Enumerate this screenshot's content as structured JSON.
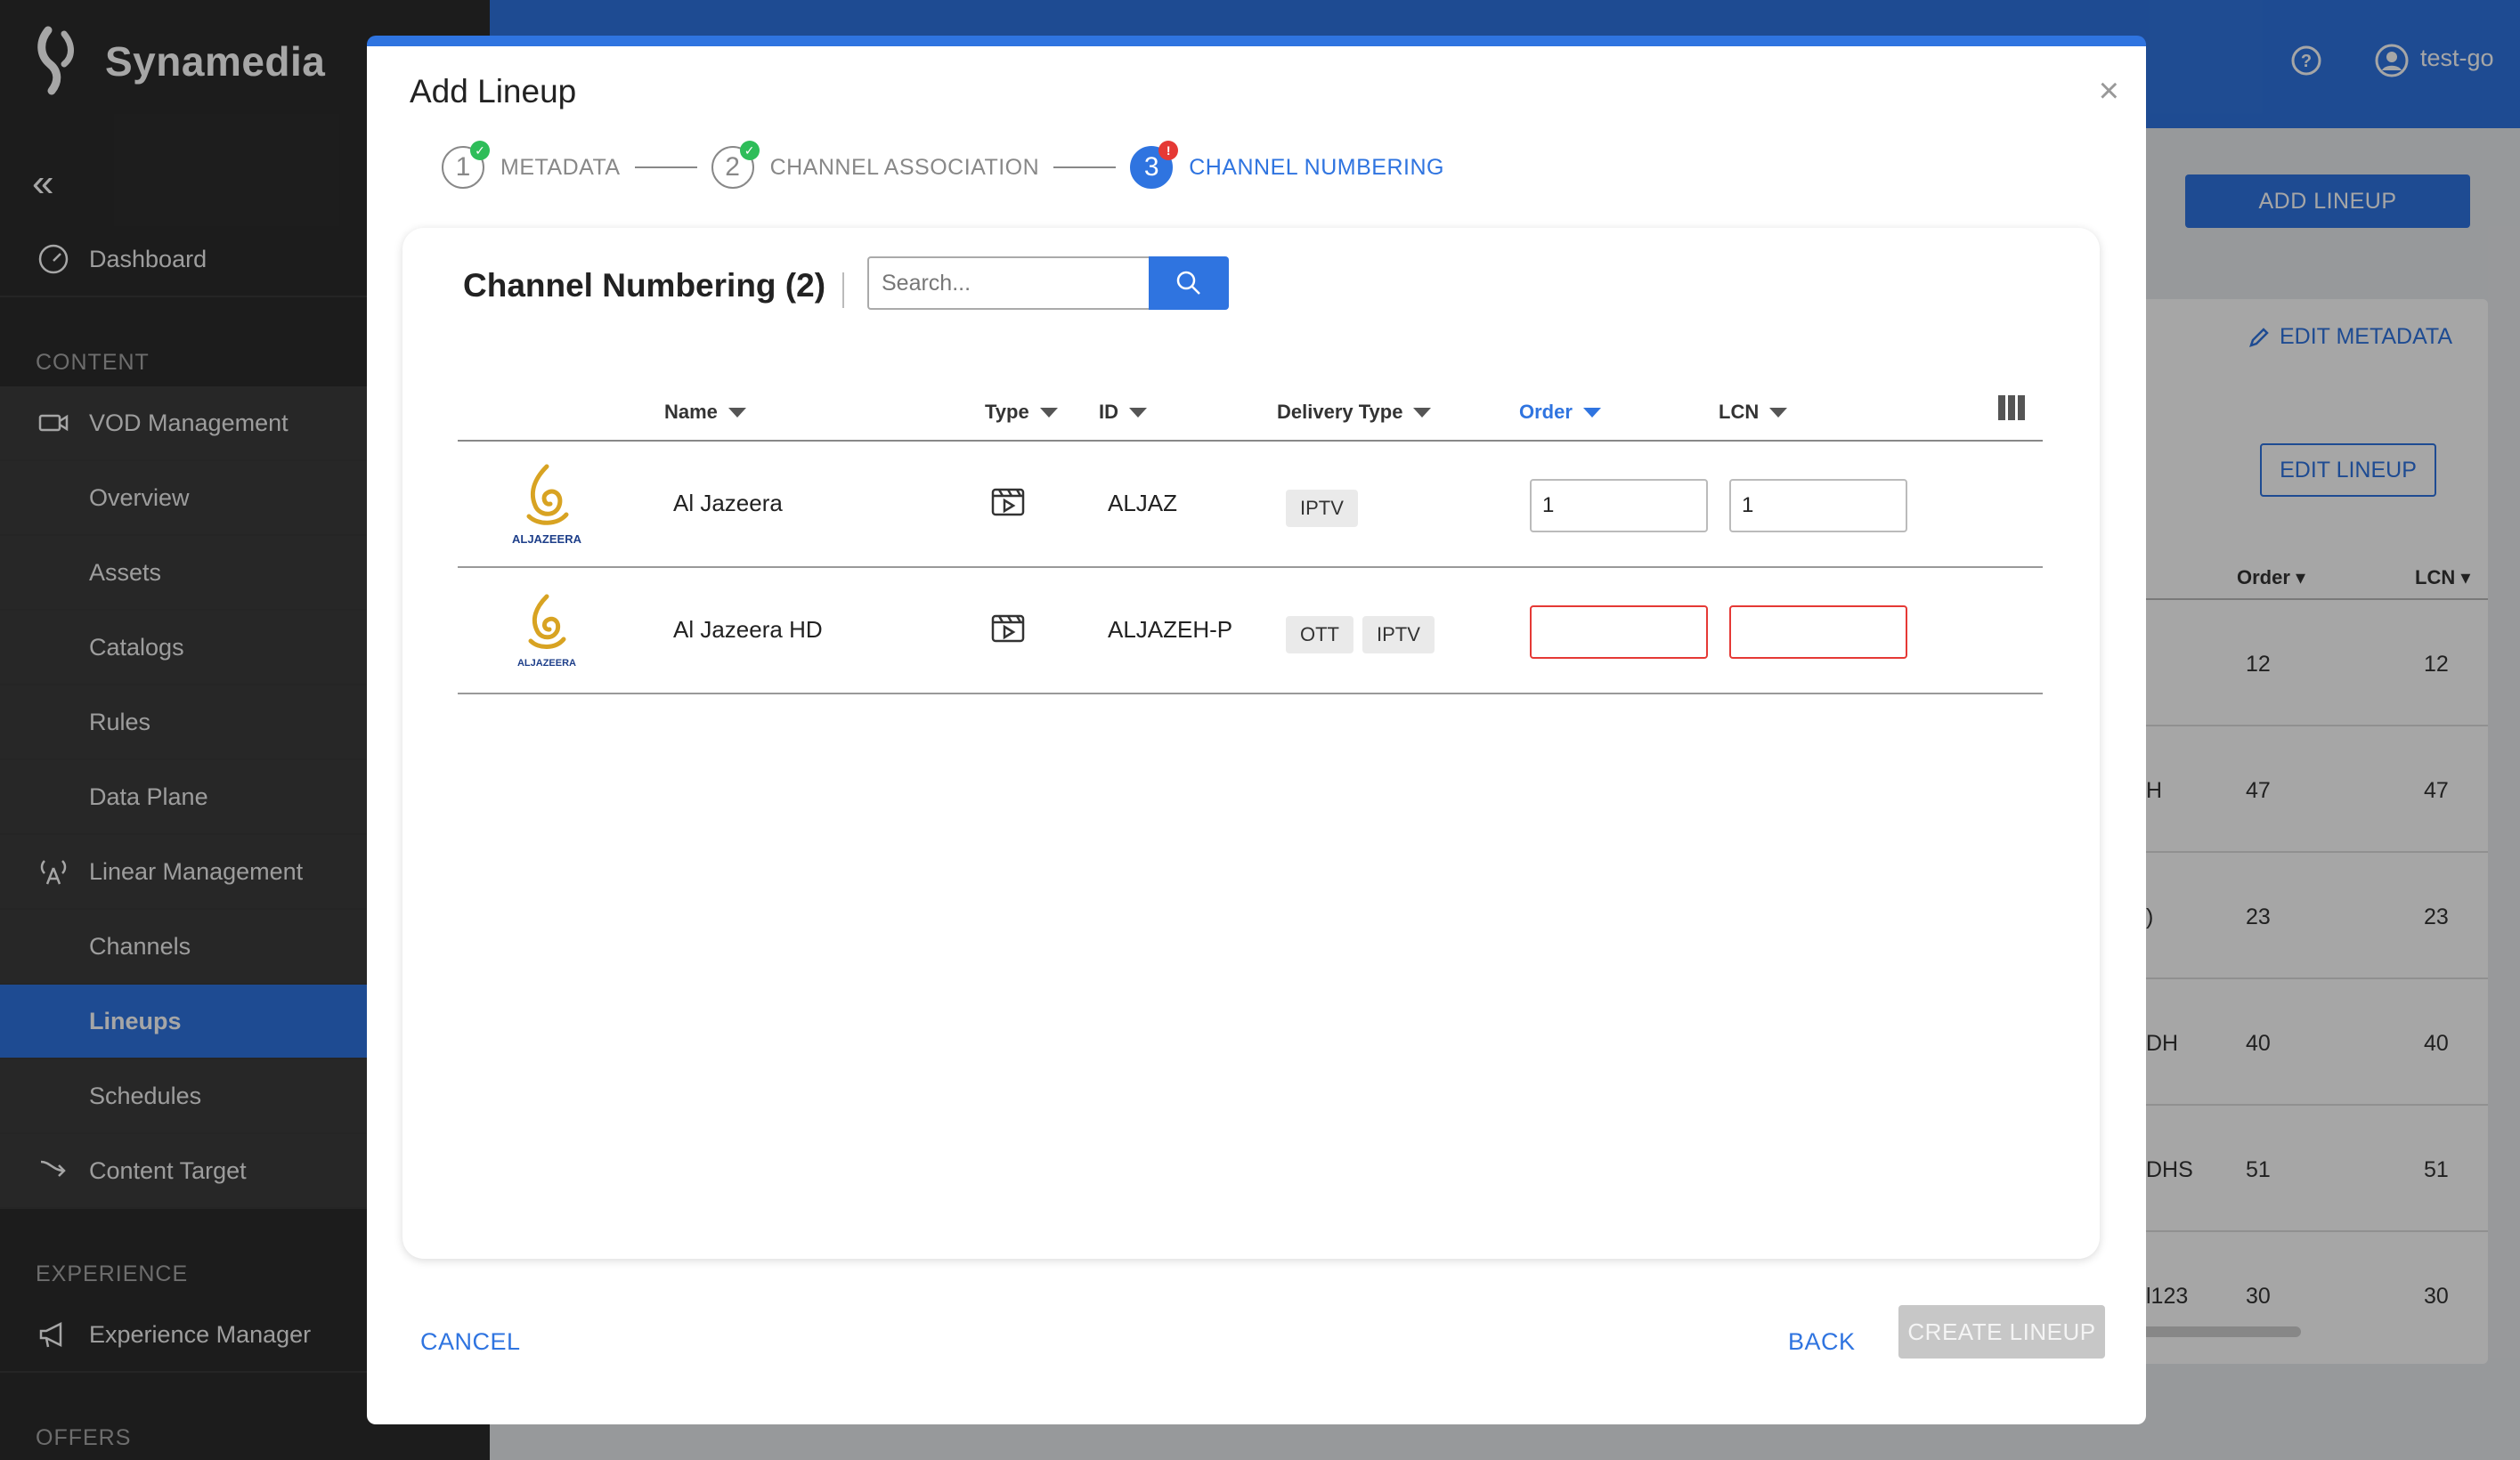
{
  "brand": {
    "name": "Synamedia"
  },
  "sidebar": {
    "items": [
      {
        "label": "Dashboard"
      },
      {
        "section": "CONTENT"
      },
      {
        "label": "VOD Management"
      },
      {
        "label": "Overview"
      },
      {
        "label": "Assets"
      },
      {
        "label": "Catalogs"
      },
      {
        "label": "Rules"
      },
      {
        "label": "Data Plane"
      },
      {
        "label": "Linear Management"
      },
      {
        "label": "Channels"
      },
      {
        "label": "Lineups",
        "active": true
      },
      {
        "label": "Schedules"
      },
      {
        "label": "Content Target"
      },
      {
        "section": "EXPERIENCE"
      },
      {
        "label": "Experience Manager"
      },
      {
        "section": "OFFERS"
      }
    ]
  },
  "topbar": {
    "user": "test-go"
  },
  "background": {
    "add_lineup": "ADD LINEUP",
    "edit_metadata": "EDIT METADATA",
    "edit_lineup": "EDIT LINEUP",
    "headers": {
      "order": "Order",
      "lcn": "LCN"
    },
    "rows": [
      {
        "name": "",
        "order": "12",
        "lcn": "12"
      },
      {
        "name": "H",
        "order": "47",
        "lcn": "47"
      },
      {
        "name": ")",
        "order": "23",
        "lcn": "23"
      },
      {
        "name": "DH",
        "order": "40",
        "lcn": "40"
      },
      {
        "name": "DHS",
        "order": "51",
        "lcn": "51"
      },
      {
        "name": "l123",
        "order": "30",
        "lcn": "30"
      }
    ]
  },
  "modal": {
    "title": "Add Lineup",
    "steps": [
      {
        "number": "1",
        "label": "METADATA",
        "status": "complete"
      },
      {
        "number": "2",
        "label": "CHANNEL ASSOCIATION",
        "status": "complete"
      },
      {
        "number": "3",
        "label": "CHANNEL NUMBERING",
        "status": "error"
      }
    ],
    "panel": {
      "title": "Channel Numbering (2)",
      "search_placeholder": "Search...",
      "columns": {
        "name": "Name",
        "type": "Type",
        "id": "ID",
        "delivery": "Delivery Type",
        "order": "Order",
        "lcn": "LCN"
      },
      "rows": [
        {
          "logo_text": "ALJAZEERA",
          "name": "Al Jazeera",
          "id": "ALJAZ",
          "delivery": [
            "IPTV"
          ],
          "order": "1",
          "lcn": "1"
        },
        {
          "logo_text": "ALJAZEERA",
          "name": "Al Jazeera HD",
          "id": "ALJAZEH-P",
          "delivery": [
            "OTT",
            "IPTV"
          ],
          "order": "",
          "lcn": ""
        }
      ]
    },
    "footer": {
      "cancel": "CANCEL",
      "back": "BACK",
      "create": "CREATE LINEUP"
    }
  },
  "colors": {
    "accent": "#2f74e0",
    "error": "#e53935",
    "success": "#2ebd59",
    "sidebar": "#2c2c2c"
  }
}
